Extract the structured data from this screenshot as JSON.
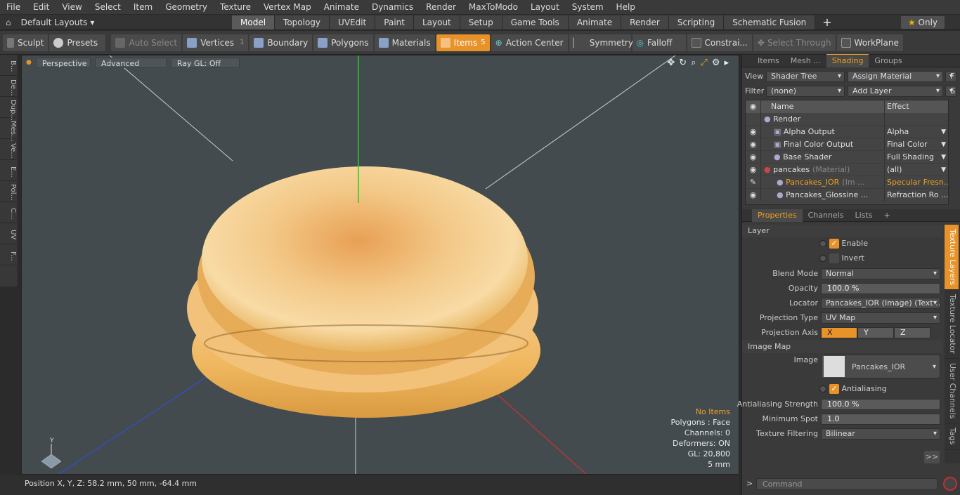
{
  "menubar": {
    "items": [
      "File",
      "Edit",
      "View",
      "Select",
      "Item",
      "Geometry",
      "Texture",
      "Vertex Map",
      "Animate",
      "Dynamics",
      "Render",
      "MaxToModo",
      "Layout",
      "System",
      "Help"
    ]
  },
  "layoutbar": {
    "layouts_label": "Default Layouts",
    "tabs": [
      "Model",
      "Topology",
      "UVEdit",
      "Paint",
      "Layout",
      "Setup",
      "Game Tools",
      "Animate",
      "Render",
      "Scripting",
      "Schematic Fusion"
    ],
    "active_tab": "Model",
    "add_label": "+",
    "only_label": "Only"
  },
  "toolbar": {
    "sculpt": "Sculpt",
    "presets": "Presets",
    "auto_select": "Auto Select",
    "vertices": "Vertices",
    "vertices_count": "1",
    "boundary": "Boundary",
    "polygons": "Polygons",
    "materials": "Materials",
    "items": "Items",
    "items_count": "5",
    "action_center": "Action Center",
    "symmetry": "Symmetry",
    "falloff": "Falloff",
    "constraints": "Constrai...",
    "select_through": "Select Through",
    "workplane": "WorkPlane"
  },
  "lefttabs": [
    "B...",
    "De...",
    "Dup...",
    "Mes...",
    "Ve...",
    "E...",
    "Pol...",
    "C...",
    "UV",
    "F..."
  ],
  "viewport": {
    "perspective": "Perspective",
    "advanced": "Advanced",
    "raygl": "Ray GL: Off",
    "stats": {
      "items": "No Items",
      "polygons": "Polygons : Face",
      "channels": "Channels: 0",
      "deformers": "Deformers: ON",
      "gl": "GL: 20,800",
      "scale": "5 mm"
    }
  },
  "statusbar": {
    "position": "Position X, Y, Z:   58.2 mm, 50 mm, -64.4 mm"
  },
  "rightpanel": {
    "tabs": [
      "Items",
      "Mesh ...",
      "Shading",
      "Groups"
    ],
    "active_tab": "Shading",
    "view_label": "View",
    "view_value": "Shader Tree",
    "assign_material": "Assign Material",
    "f_btn": "F",
    "filter_label": "Filter",
    "filter_value": "(none)",
    "add_layer": "Add Layer",
    "s_btn": "S",
    "col_name": "Name",
    "col_effect": "Effect",
    "rows": [
      {
        "name": "Render",
        "effect": ""
      },
      {
        "name": "Alpha Output",
        "effect": "Alpha"
      },
      {
        "name": "Final Color Output",
        "effect": "Final Color"
      },
      {
        "name": "Base Shader",
        "effect": "Full Shading"
      },
      {
        "name": "pancakes",
        "extra": "(Material)",
        "effect": "(all)"
      },
      {
        "name": "Pancakes_IOR",
        "extra": "(Im ...",
        "effect": "Specular Fresn..."
      },
      {
        "name": "Pancakes_Glossine ...",
        "effect": "Refraction Ro ..."
      }
    ]
  },
  "properties": {
    "tabs": [
      "Properties",
      "Channels",
      "Lists",
      "+"
    ],
    "active_tab": "Properties",
    "layer_section": "Layer",
    "enable": "Enable",
    "invert": "Invert",
    "blend_mode_label": "Blend Mode",
    "blend_mode": "Normal",
    "opacity_label": "Opacity",
    "opacity": "100.0 %",
    "locator_label": "Locator",
    "locator": "Pancakes_IOR (Image) (Text ...",
    "proj_type_label": "Projection Type",
    "proj_type": "UV Map",
    "proj_axis_label": "Projection Axis",
    "axis_x": "X",
    "axis_y": "Y",
    "axis_z": "Z",
    "image_map_section": "Image Map",
    "image_label": "Image",
    "image_value": "Pancakes_IOR",
    "antialiasing": "Antialiasing",
    "aa_strength_label": "Antialiasing Strength",
    "aa_strength": "100.0 %",
    "min_spot_label": "Minimum Spot",
    "min_spot": "1.0",
    "tex_filter_label": "Texture Filtering",
    "tex_filter": "Bilinear",
    "more": ">>",
    "sidetabs": [
      "Texture Layers",
      "Texture Locator",
      "User Channels",
      "Tags"
    ],
    "command_placeholder": "Command"
  }
}
